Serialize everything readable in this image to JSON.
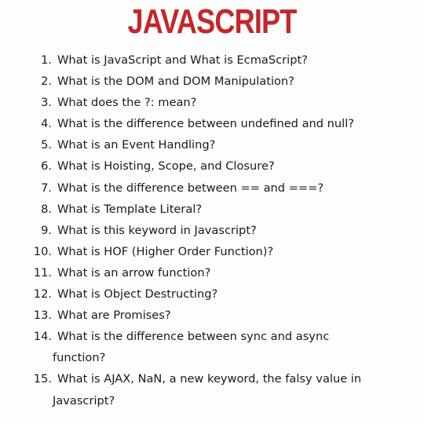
{
  "title": "JAVASCRIPT",
  "questions": [
    {
      "num": "1.",
      "line1": "What is JavaScript and What is EcmaScript?"
    },
    {
      "num": "2.",
      "line1": "What is the DOM and DOM Manipulation?"
    },
    {
      "num": "3.",
      "line1": "What does the ?: mean?"
    },
    {
      "num": "4.",
      "line1": "What is the difference between undefined and null?"
    },
    {
      "num": "5.",
      "line1": "What is an Event Handling?"
    },
    {
      "num": "6.",
      "line1": "What is Hoisting, Scope, and Closure?"
    },
    {
      "num": "7.",
      "line1": "What is the difference between == and ===?"
    },
    {
      "num": "8.",
      "line1": "What is Template Literal?"
    },
    {
      "num": "9.",
      "line1": "What is this keyword in Javascript?"
    },
    {
      "num": "10.",
      "line1": "What is HOF (Higher Order Function)?"
    },
    {
      "num": "11.",
      "line1": "What is an arrow function?"
    },
    {
      "num": "12.",
      "line1": "What is Object Destructing?"
    },
    {
      "num": "13.",
      "line1": "What are Promises?"
    },
    {
      "num": "14.",
      "line1": "What is the difference between sync and async",
      "line2": "function?"
    },
    {
      "num": "15.",
      "line1": "What is AJAX, NaN, a new keyword, the falsy value in",
      "line2": "Javascript?"
    }
  ]
}
